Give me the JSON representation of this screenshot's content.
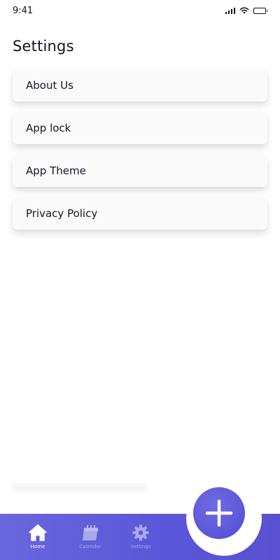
{
  "status_bar": {
    "time": "9:41"
  },
  "page": {
    "title": "Settings"
  },
  "settings_items": [
    {
      "label": "About Us"
    },
    {
      "label": "App lock"
    },
    {
      "label": "App Theme"
    },
    {
      "label": "Privacy Policy"
    }
  ],
  "bottom_nav": {
    "items": [
      {
        "label": "Home",
        "icon": "home-icon",
        "active": true
      },
      {
        "label": "Calender",
        "icon": "calendar-icon",
        "active": false
      },
      {
        "label": "Settings",
        "icon": "gear-icon",
        "active": false
      }
    ],
    "fab_icon": "plus-icon"
  },
  "colors": {
    "accent": "#5e59d9",
    "nav_inactive": "#a9a7ee",
    "nav_active": "#ffffff"
  }
}
